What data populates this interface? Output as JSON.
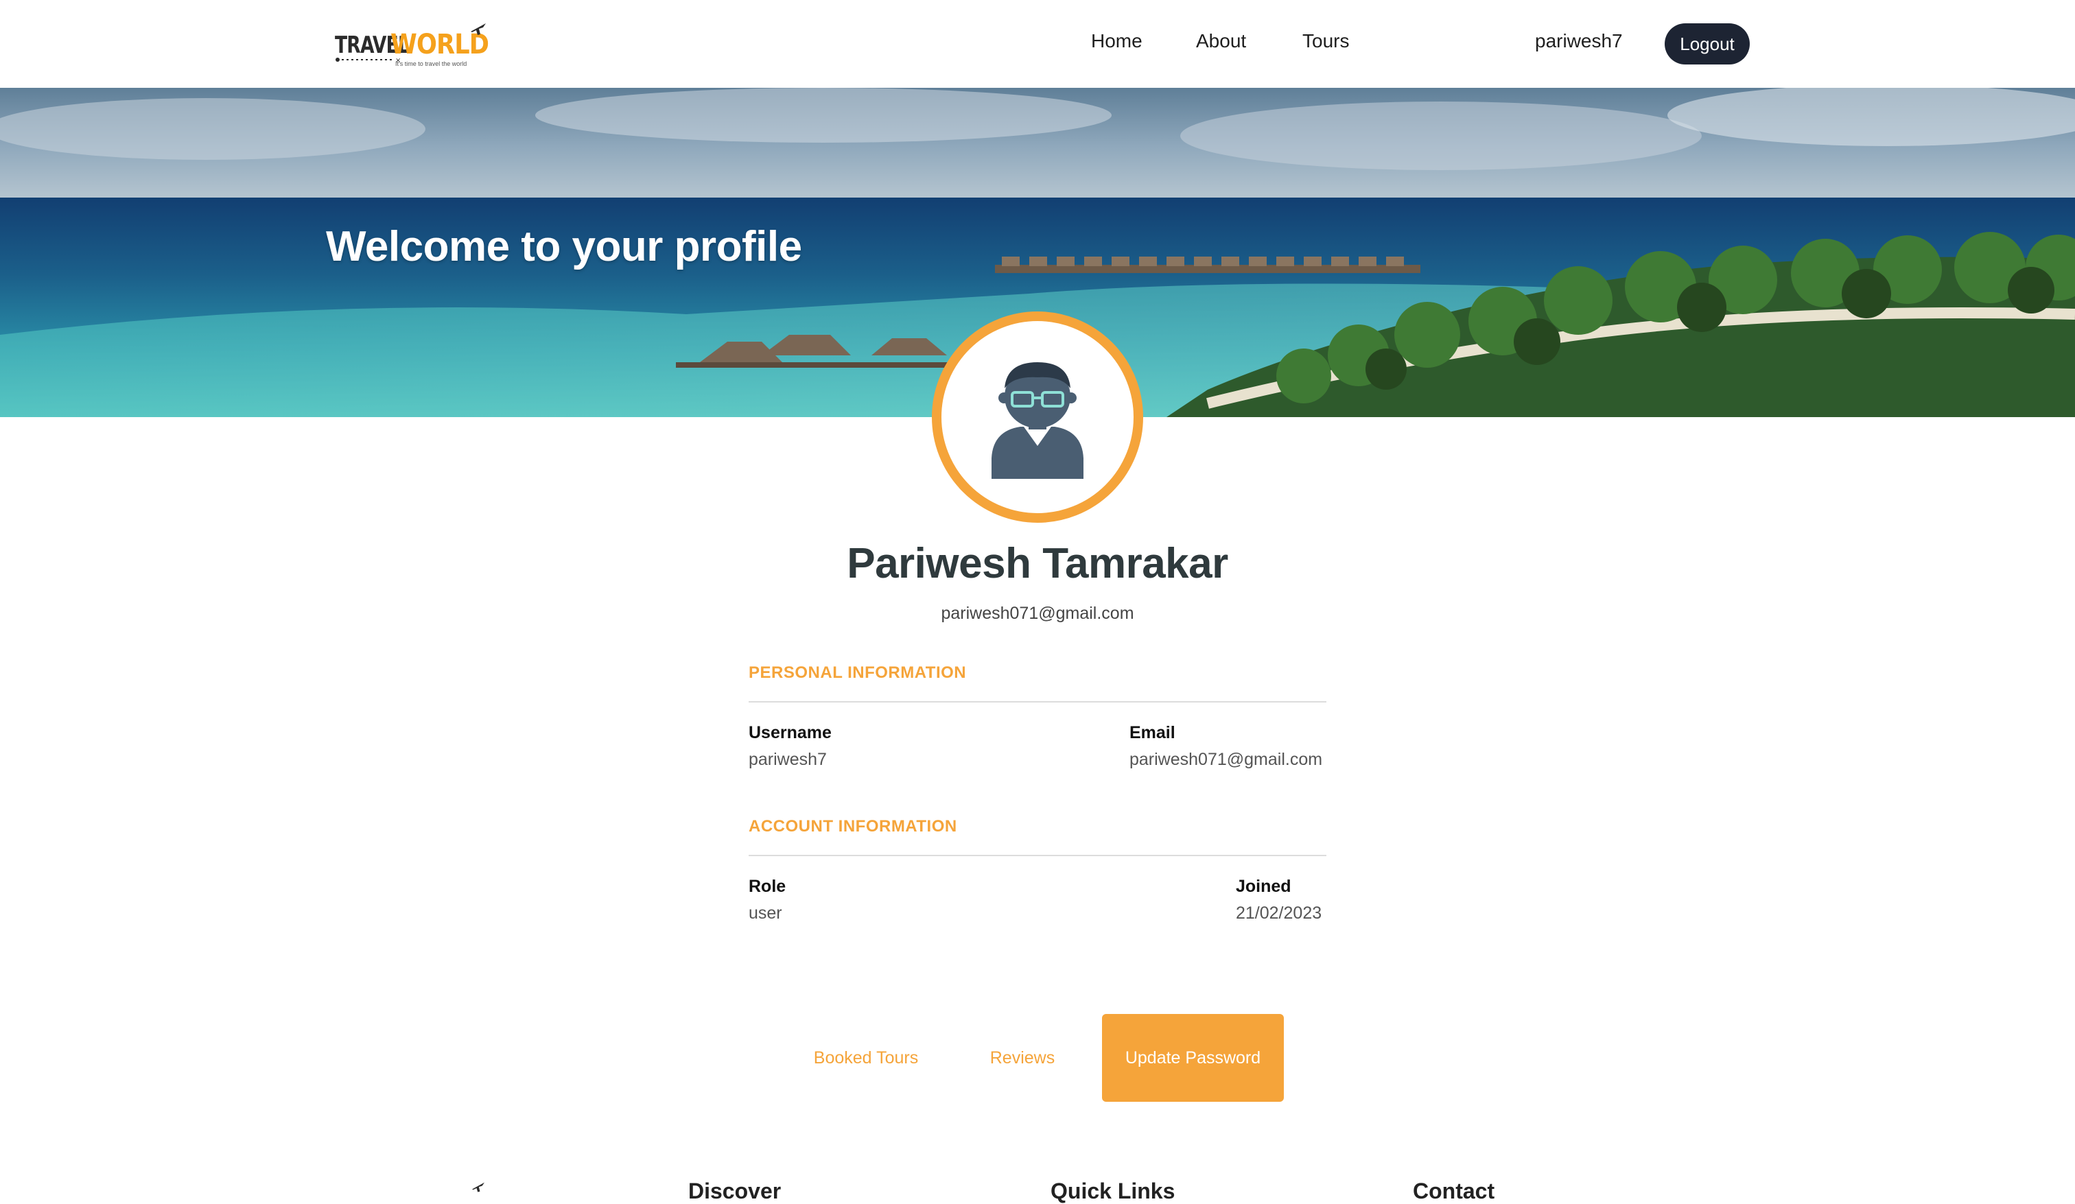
{
  "header": {
    "logo": {
      "word1": "TRAVEL",
      "word2": "WORLD",
      "tagline": "It's time to travel the world"
    },
    "nav": [
      {
        "label": "Home"
      },
      {
        "label": "About"
      },
      {
        "label": "Tours"
      }
    ],
    "username": "pariwesh7",
    "logout_label": "Logout"
  },
  "hero": {
    "title": "Welcome to your profile"
  },
  "profile": {
    "full_name": "Pariwesh Tamrakar",
    "email": "pariwesh071@gmail.com",
    "personal": {
      "title": "PERSONAL INFORMATION",
      "username_label": "Username",
      "username_value": "pariwesh7",
      "email_label": "Email",
      "email_value": "pariwesh071@gmail.com"
    },
    "account": {
      "title": "ACCOUNT INFORMATION",
      "role_label": "Role",
      "role_value": "user",
      "joined_label": "Joined",
      "joined_value": "21/02/2023"
    }
  },
  "tabs": [
    {
      "label": "Booked Tours",
      "active": false
    },
    {
      "label": "Reviews",
      "active": false
    },
    {
      "label": "Update Password",
      "active": true
    }
  ],
  "footer": {
    "headings": [
      "Discover",
      "Quick Links",
      "Contact"
    ]
  },
  "colors": {
    "accent": "#f5a43a",
    "dark_button": "#1d2433"
  }
}
